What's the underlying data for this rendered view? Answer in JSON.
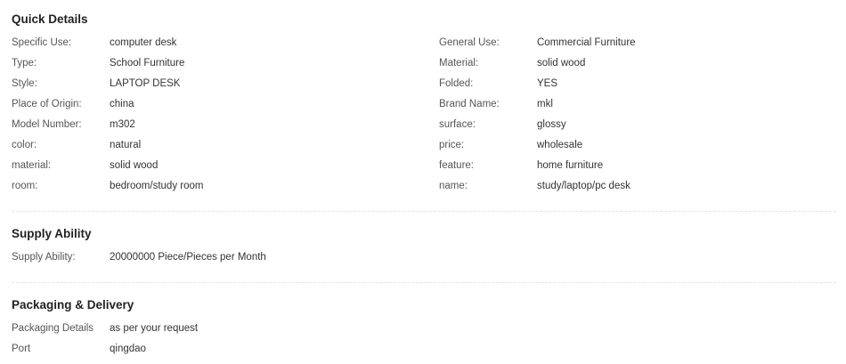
{
  "quick_details": {
    "title": "Quick Details",
    "left": [
      {
        "label": "Specific Use:",
        "value": "computer desk"
      },
      {
        "label": "Type:",
        "value": "School Furniture"
      },
      {
        "label": "Style:",
        "value": "LAPTOP DESK"
      },
      {
        "label": "Place of Origin:",
        "value": "china"
      },
      {
        "label": "Model Number:",
        "value": "m302"
      },
      {
        "label": "color:",
        "value": "natural"
      },
      {
        "label": "material:",
        "value": "solid wood"
      },
      {
        "label": "room:",
        "value": "bedroom/study room"
      }
    ],
    "right": [
      {
        "label": "General Use:",
        "value": "Commercial Furniture"
      },
      {
        "label": "Material:",
        "value": "solid wood"
      },
      {
        "label": "Folded:",
        "value": "YES"
      },
      {
        "label": "Brand Name:",
        "value": "mkl"
      },
      {
        "label": "surface:",
        "value": "glossy"
      },
      {
        "label": "price:",
        "value": "wholesale"
      },
      {
        "label": "feature:",
        "value": "home furniture"
      },
      {
        "label": "name:",
        "value": "study/laptop/pc desk"
      }
    ]
  },
  "supply_ability": {
    "title": "Supply Ability",
    "rows": [
      {
        "label": "Supply Ability:",
        "value": "20000000 Piece/Pieces per Month"
      }
    ]
  },
  "packaging_delivery": {
    "title": "Packaging & Delivery",
    "rows": [
      {
        "label": "Packaging Details",
        "value": "as per your request"
      },
      {
        "label": "Port",
        "value": "qingdao"
      }
    ]
  }
}
